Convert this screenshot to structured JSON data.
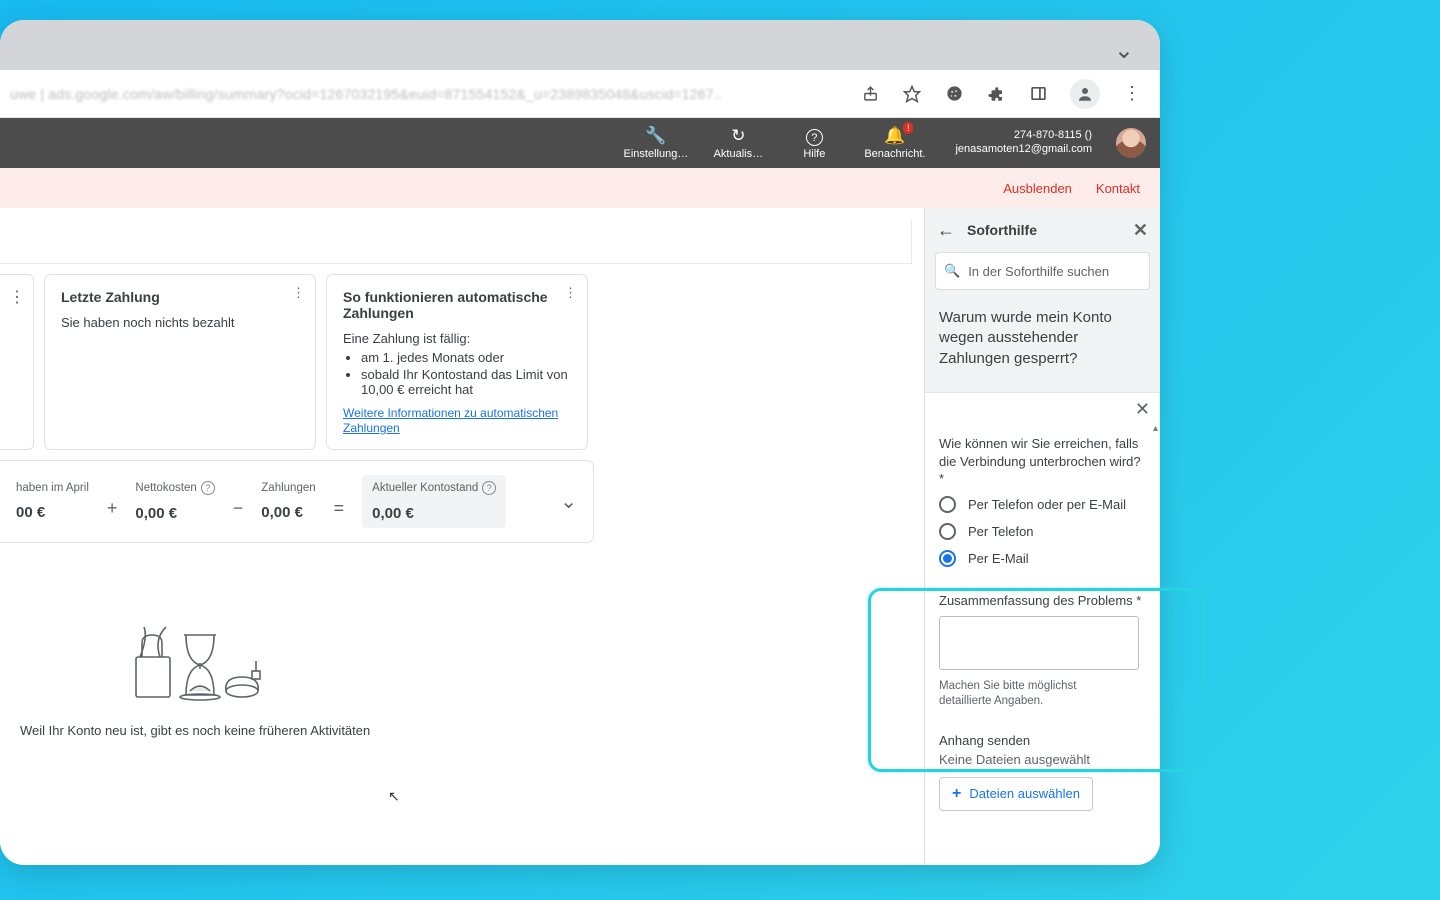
{
  "chrome": {
    "url_blur": "uwe | ads.google.com/aw/billing/summary?ocid=1267032195&euid=871554152&_u=2389835048&uscid=1267..",
    "icons": {
      "share": "share-icon",
      "star": "star-icon",
      "cookie": "cookie-icon",
      "ext": "puzzle-icon",
      "panel": "sidepanel-icon",
      "avatar": "avatar-icon",
      "menu": "kebab-icon"
    }
  },
  "adsbar": {
    "tools": {
      "settings": "Einstellung…",
      "refresh": "Aktualis…",
      "help": "Hilfe",
      "notif": "Benachricht.",
      "notif_badge": "!"
    },
    "account_id": "274-870-8115 ()",
    "account_email": "jenasamoten12@gmail.com"
  },
  "banner": {
    "hide": "Ausblenden",
    "contact": "Kontakt"
  },
  "cards": {
    "last_payment": {
      "title": "Letzte Zahlung",
      "body": "Sie haben noch nichts bezahlt"
    },
    "auto_pay": {
      "title": "So funktionieren automatische Zahlungen",
      "due_label": "Eine Zahlung ist fällig:",
      "bullet1": "am 1. jedes Monats oder",
      "bullet2": "sobald Ihr Kontostand das Limit von 10,00 € erreicht hat",
      "link": "Weitere Informationen zu automatischen Zahlungen"
    }
  },
  "summary": {
    "cell1_label": "haben im April",
    "cell1_value": "00 €",
    "cell2_label": "Nettokosten",
    "cell2_value": "0,00 €",
    "cell3_label": "Zahlungen",
    "cell3_value": "0,00 €",
    "cell4_label": "Aktueller Kontostand",
    "cell4_value": "0,00 €"
  },
  "empty_msg": "Weil Ihr Konto neu ist, gibt es noch keine früheren Aktivitäten",
  "side": {
    "title": "Soforthilfe",
    "search_ph": "In der Soforthilfe suchen",
    "question": "Warum wurde mein Konto wegen ausstehender Zahlungen gesperrt?"
  },
  "form": {
    "reach_q": "Wie können wir Sie erreichen, falls die Verbindung unterbrochen wird? *",
    "opt1": "Per Telefon oder per E-Mail",
    "opt2": "Per Telefon",
    "opt3": "Per E-Mail",
    "summary_label": "Zusammenfassung des Problems *",
    "summary_hint": "Machen Sie bitte möglichst detaillierte Angaben.",
    "attach_label": "Anhang senden",
    "attach_status": "Keine Dateien ausgewählt",
    "choose_files": "Dateien auswählen"
  }
}
